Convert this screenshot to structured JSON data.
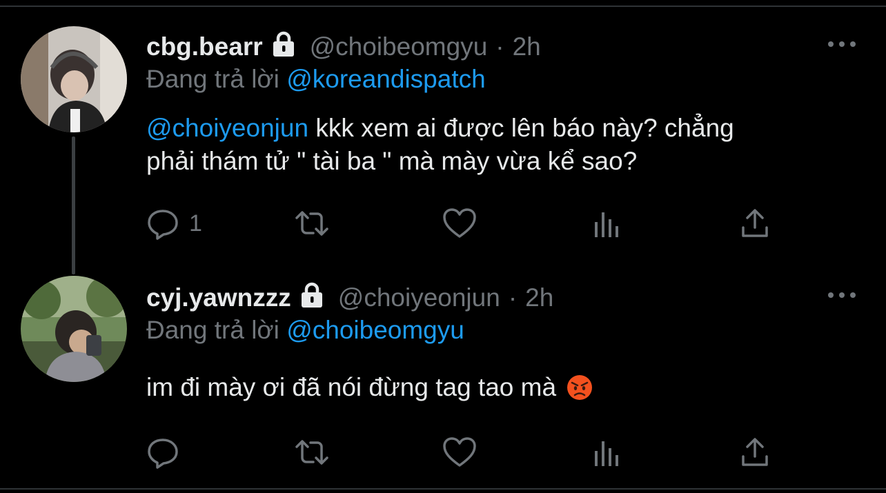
{
  "tweets": [
    {
      "display_name": "cbg.bearr",
      "handle": "@choibeomgyu",
      "separator": "·",
      "time": "2h",
      "replying_prefix": "Đang trả lời",
      "replying_to": "@koreandispatch",
      "body_mention": "@choiyeonjun",
      "body_line1_rest": " kkk xem ai được lên báo này? chẳng",
      "body_line2": "phải thám tử \" tài ba \" mà mày vừa kể sao?",
      "reply_count": "1"
    },
    {
      "display_name": "cyj.yawnzzz",
      "handle": "@choiyeonjun",
      "separator": "·",
      "time": "2h",
      "replying_prefix": "Đang trả lời",
      "replying_to": "@choibeomgyu",
      "body_text": "im đi mày ơi đã nói đừng tag tao mà",
      "body_emoji": "angry-face-emoji",
      "reply_count": ""
    }
  ],
  "icons": {
    "lock": "lock-icon",
    "more": "more-icon",
    "reply": "reply-icon",
    "retweet": "retweet-icon",
    "like": "like-icon",
    "views": "views-icon",
    "share": "share-icon"
  },
  "colors": {
    "background": "#000000",
    "text": "#e7e9ea",
    "secondary": "#71767b",
    "accent": "#1d9bf0"
  }
}
